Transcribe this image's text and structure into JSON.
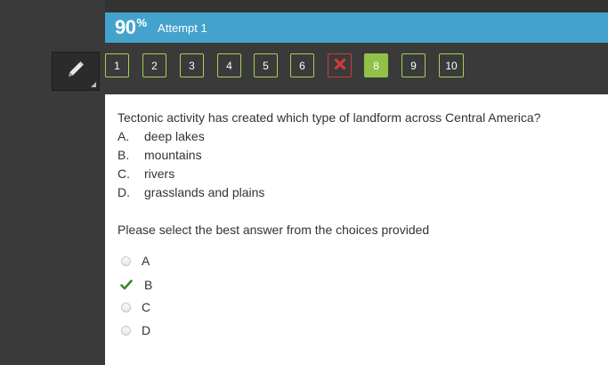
{
  "header": {
    "score": "90",
    "score_suffix": "%",
    "attempt": "Attempt 1",
    "color": "#44a3cc"
  },
  "tools": {
    "pencil_icon": "pencil-icon"
  },
  "question_nav": [
    {
      "label": "1",
      "state": "answered"
    },
    {
      "label": "2",
      "state": "answered"
    },
    {
      "label": "3",
      "state": "answered"
    },
    {
      "label": "4",
      "state": "answered"
    },
    {
      "label": "5",
      "state": "answered"
    },
    {
      "label": "6",
      "state": "answered"
    },
    {
      "label": "",
      "state": "wrong",
      "icon": "x-icon"
    },
    {
      "label": "8",
      "state": "current"
    },
    {
      "label": "9",
      "state": "answered"
    },
    {
      "label": "10",
      "state": "answered"
    }
  ],
  "question": {
    "text": "Tectonic activity has created which type of landform across Central America?",
    "options": [
      {
        "letter": "A.",
        "text": "deep lakes"
      },
      {
        "letter": "B.",
        "text": "mountains"
      },
      {
        "letter": "C.",
        "text": "rivers"
      },
      {
        "letter": "D.",
        "text": "grasslands and plains"
      }
    ],
    "instruction": "Please select the best answer from the choices provided"
  },
  "answers": [
    {
      "label": "A",
      "selected": false
    },
    {
      "label": "B",
      "selected": true,
      "icon": "checkmark-icon"
    },
    {
      "label": "C",
      "selected": false
    },
    {
      "label": "D",
      "selected": false
    }
  ],
  "colors": {
    "correct_green": "#3a8a2a",
    "wrong_red": "#d23a3a",
    "nav_border": "#a6cf56",
    "current_fill": "#92c14a"
  }
}
